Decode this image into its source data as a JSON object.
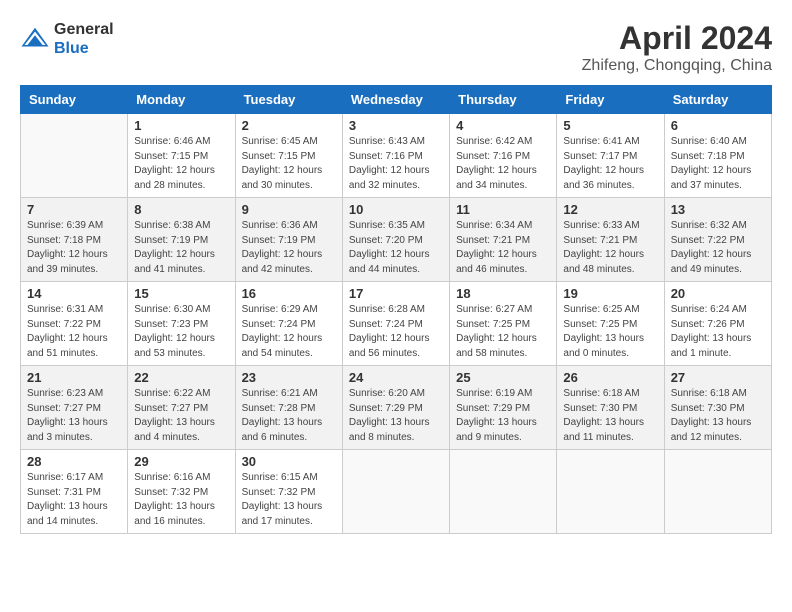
{
  "header": {
    "logo_line1": "General",
    "logo_line2": "Blue",
    "month_year": "April 2024",
    "location": "Zhifeng, Chongqing, China"
  },
  "weekdays": [
    "Sunday",
    "Monday",
    "Tuesday",
    "Wednesday",
    "Thursday",
    "Friday",
    "Saturday"
  ],
  "weeks": [
    [
      {
        "day": "",
        "detail": ""
      },
      {
        "day": "1",
        "detail": "Sunrise: 6:46 AM\nSunset: 7:15 PM\nDaylight: 12 hours\nand 28 minutes."
      },
      {
        "day": "2",
        "detail": "Sunrise: 6:45 AM\nSunset: 7:15 PM\nDaylight: 12 hours\nand 30 minutes."
      },
      {
        "day": "3",
        "detail": "Sunrise: 6:43 AM\nSunset: 7:16 PM\nDaylight: 12 hours\nand 32 minutes."
      },
      {
        "day": "4",
        "detail": "Sunrise: 6:42 AM\nSunset: 7:16 PM\nDaylight: 12 hours\nand 34 minutes."
      },
      {
        "day": "5",
        "detail": "Sunrise: 6:41 AM\nSunset: 7:17 PM\nDaylight: 12 hours\nand 36 minutes."
      },
      {
        "day": "6",
        "detail": "Sunrise: 6:40 AM\nSunset: 7:18 PM\nDaylight: 12 hours\nand 37 minutes."
      }
    ],
    [
      {
        "day": "7",
        "detail": "Sunrise: 6:39 AM\nSunset: 7:18 PM\nDaylight: 12 hours\nand 39 minutes."
      },
      {
        "day": "8",
        "detail": "Sunrise: 6:38 AM\nSunset: 7:19 PM\nDaylight: 12 hours\nand 41 minutes."
      },
      {
        "day": "9",
        "detail": "Sunrise: 6:36 AM\nSunset: 7:19 PM\nDaylight: 12 hours\nand 42 minutes."
      },
      {
        "day": "10",
        "detail": "Sunrise: 6:35 AM\nSunset: 7:20 PM\nDaylight: 12 hours\nand 44 minutes."
      },
      {
        "day": "11",
        "detail": "Sunrise: 6:34 AM\nSunset: 7:21 PM\nDaylight: 12 hours\nand 46 minutes."
      },
      {
        "day": "12",
        "detail": "Sunrise: 6:33 AM\nSunset: 7:21 PM\nDaylight: 12 hours\nand 48 minutes."
      },
      {
        "day": "13",
        "detail": "Sunrise: 6:32 AM\nSunset: 7:22 PM\nDaylight: 12 hours\nand 49 minutes."
      }
    ],
    [
      {
        "day": "14",
        "detail": "Sunrise: 6:31 AM\nSunset: 7:22 PM\nDaylight: 12 hours\nand 51 minutes."
      },
      {
        "day": "15",
        "detail": "Sunrise: 6:30 AM\nSunset: 7:23 PM\nDaylight: 12 hours\nand 53 minutes."
      },
      {
        "day": "16",
        "detail": "Sunrise: 6:29 AM\nSunset: 7:24 PM\nDaylight: 12 hours\nand 54 minutes."
      },
      {
        "day": "17",
        "detail": "Sunrise: 6:28 AM\nSunset: 7:24 PM\nDaylight: 12 hours\nand 56 minutes."
      },
      {
        "day": "18",
        "detail": "Sunrise: 6:27 AM\nSunset: 7:25 PM\nDaylight: 12 hours\nand 58 minutes."
      },
      {
        "day": "19",
        "detail": "Sunrise: 6:25 AM\nSunset: 7:25 PM\nDaylight: 13 hours\nand 0 minutes."
      },
      {
        "day": "20",
        "detail": "Sunrise: 6:24 AM\nSunset: 7:26 PM\nDaylight: 13 hours\nand 1 minute."
      }
    ],
    [
      {
        "day": "21",
        "detail": "Sunrise: 6:23 AM\nSunset: 7:27 PM\nDaylight: 13 hours\nand 3 minutes."
      },
      {
        "day": "22",
        "detail": "Sunrise: 6:22 AM\nSunset: 7:27 PM\nDaylight: 13 hours\nand 4 minutes."
      },
      {
        "day": "23",
        "detail": "Sunrise: 6:21 AM\nSunset: 7:28 PM\nDaylight: 13 hours\nand 6 minutes."
      },
      {
        "day": "24",
        "detail": "Sunrise: 6:20 AM\nSunset: 7:29 PM\nDaylight: 13 hours\nand 8 minutes."
      },
      {
        "day": "25",
        "detail": "Sunrise: 6:19 AM\nSunset: 7:29 PM\nDaylight: 13 hours\nand 9 minutes."
      },
      {
        "day": "26",
        "detail": "Sunrise: 6:18 AM\nSunset: 7:30 PM\nDaylight: 13 hours\nand 11 minutes."
      },
      {
        "day": "27",
        "detail": "Sunrise: 6:18 AM\nSunset: 7:30 PM\nDaylight: 13 hours\nand 12 minutes."
      }
    ],
    [
      {
        "day": "28",
        "detail": "Sunrise: 6:17 AM\nSunset: 7:31 PM\nDaylight: 13 hours\nand 14 minutes."
      },
      {
        "day": "29",
        "detail": "Sunrise: 6:16 AM\nSunset: 7:32 PM\nDaylight: 13 hours\nand 16 minutes."
      },
      {
        "day": "30",
        "detail": "Sunrise: 6:15 AM\nSunset: 7:32 PM\nDaylight: 13 hours\nand 17 minutes."
      },
      {
        "day": "",
        "detail": ""
      },
      {
        "day": "",
        "detail": ""
      },
      {
        "day": "",
        "detail": ""
      },
      {
        "day": "",
        "detail": ""
      }
    ]
  ]
}
